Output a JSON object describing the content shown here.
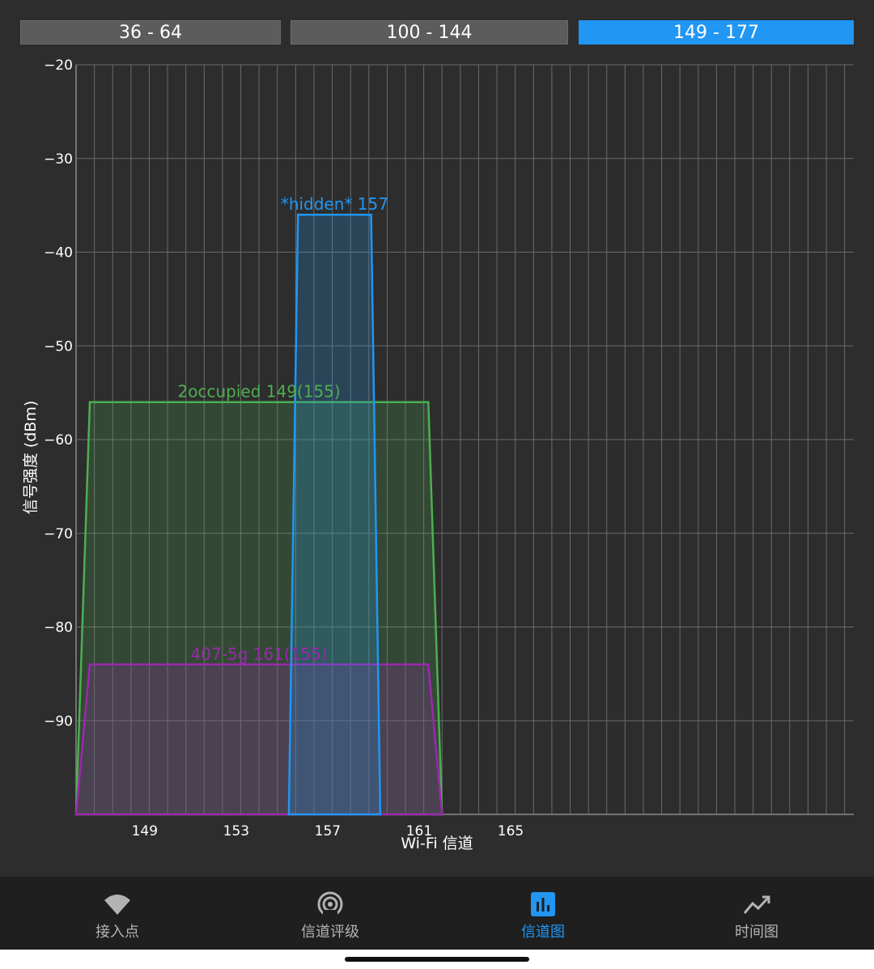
{
  "tabs": [
    {
      "label": "36 - 64",
      "active": false
    },
    {
      "label": "100 - 144",
      "active": false
    },
    {
      "label": "149 - 177",
      "active": true
    }
  ],
  "chart_data": {
    "type": "area",
    "xlabel": "Wi-Fi 信道",
    "ylabel": "信号强度 (dBm)",
    "xlim": [
      146,
      180
    ],
    "ylim": [
      -100,
      -20
    ],
    "x_ticks": [
      149,
      153,
      157,
      161,
      165
    ],
    "y_ticks": [
      -20,
      -30,
      -40,
      -50,
      -60,
      -70,
      -80,
      -90
    ],
    "grid": true,
    "series": [
      {
        "name": "2occupied 149(155)",
        "color": "#4caf50",
        "points": [
          [
            146.0,
            -100
          ],
          [
            146.6,
            -56
          ],
          [
            161.4,
            -56
          ],
          [
            162.0,
            -100
          ]
        ]
      },
      {
        "name": "407-5g 161(155)",
        "color": "#9c27b0",
        "points": [
          [
            146.0,
            -100
          ],
          [
            146.6,
            -84
          ],
          [
            161.4,
            -84
          ],
          [
            162.0,
            -100
          ]
        ]
      },
      {
        "name": "*hidden* 157",
        "color": "#2196f3",
        "points": [
          [
            155.3,
            -100
          ],
          [
            155.7,
            -36
          ],
          [
            158.9,
            -36
          ],
          [
            159.3,
            -100
          ]
        ]
      }
    ]
  },
  "nav": [
    {
      "label": "接入点",
      "icon": "wifi-icon",
      "active": false
    },
    {
      "label": "信道评级",
      "icon": "signal-rating-icon",
      "active": false
    },
    {
      "label": "信道图",
      "icon": "bar-chart-icon",
      "active": true
    },
    {
      "label": "时间图",
      "icon": "line-chart-icon",
      "active": false
    }
  ]
}
